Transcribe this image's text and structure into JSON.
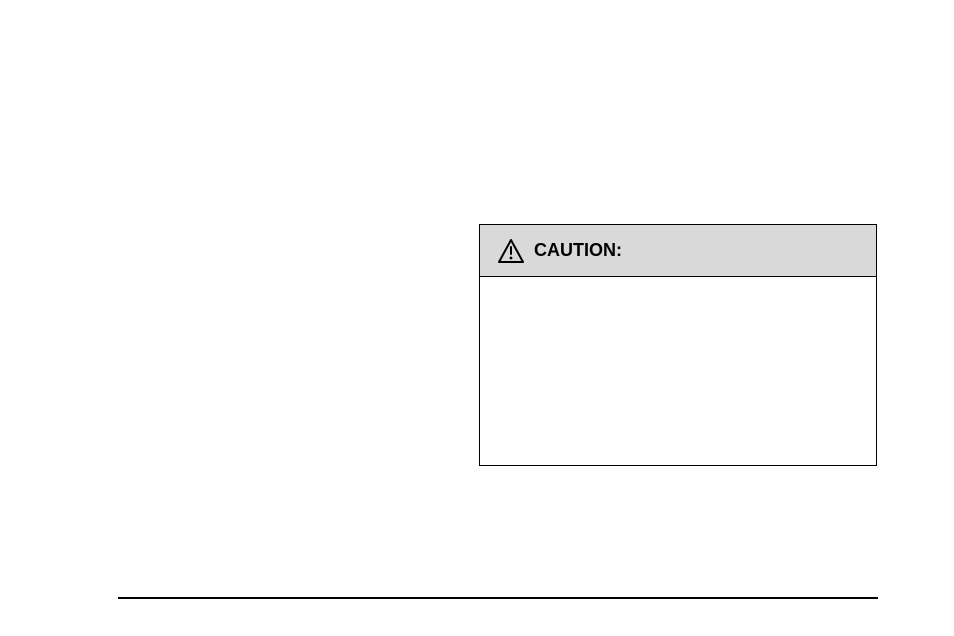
{
  "caution": {
    "title": "CAUTION:"
  }
}
